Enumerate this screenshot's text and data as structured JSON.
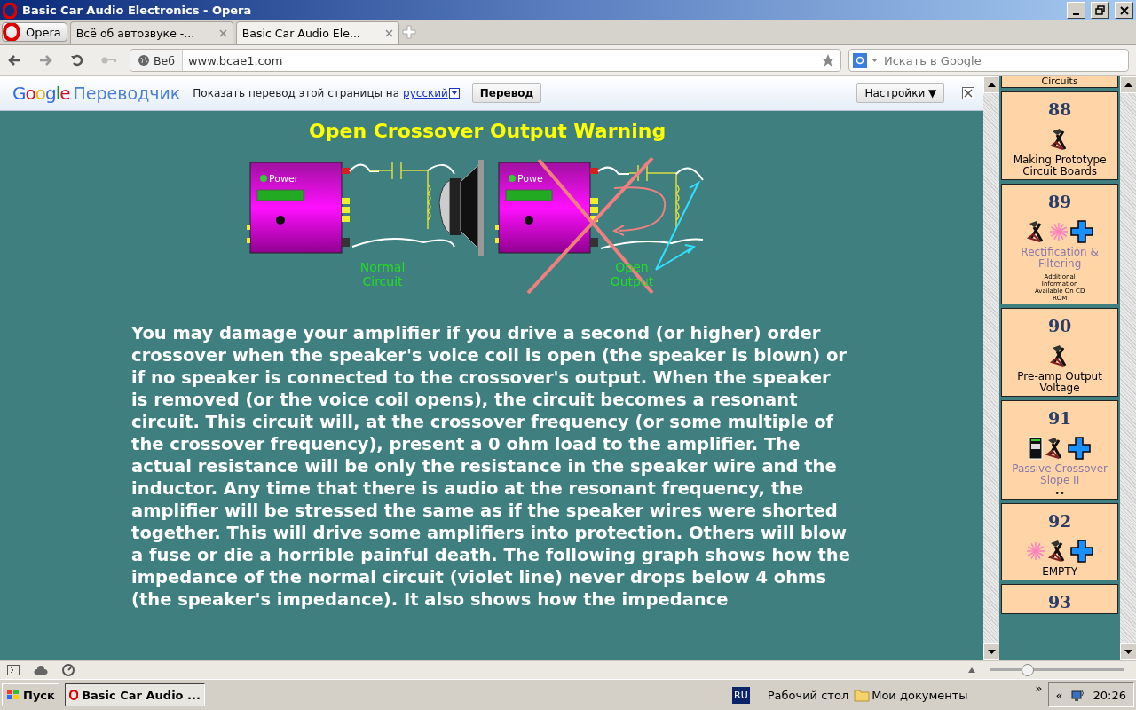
{
  "window": {
    "title": "Basic Car Audio Electronics - Opera"
  },
  "menu_button": "Opera",
  "tabs": [
    {
      "label": "Всё об автозвуке -...",
      "selected": false
    },
    {
      "label": "Basic Car Audio Ele...",
      "selected": true
    }
  ],
  "address_bar": {
    "badge": "Веб",
    "url": "www.bcae1.com"
  },
  "search": {
    "placeholder": "Искать в Google"
  },
  "translate_bar": {
    "logo_word": "Google",
    "logo_product": "Переводчик",
    "prompt": "Показать перевод этой страницы на",
    "language": "русский",
    "translate_button": "Перевод",
    "settings_button": "Настройки ▼"
  },
  "article": {
    "title": "Open Crossover Output Warning",
    "diagram": {
      "power_labels": [
        "Power",
        "Powe"
      ],
      "normal_label": "Normal Circuit",
      "open_label": "Open Output"
    },
    "paragraph": "You may damage your amplifier if you drive a second (or higher) order crossover when the speaker's voice coil is open (the speaker is blown) or if no speaker is connected to the crossover's output. When the speaker is removed (or the voice coil opens), the circuit becomes a resonant circuit. This circuit will, at the crossover frequency (or some multiple of the crossover frequency), present a 0 ohm load to the amplifier. The actual resistance will be only the resistance in the speaker wire and the inductor. Any time that there is audio at the resonant frequency, the amplifier will be stressed the same as if the speaker wires were shorted together. This will drive some amplifiers into protection. Others will blow a fuse or die a horrible painful death. The following graph shows how the impedance of the normal circuit (violet line) never drops below 4 ohms (the speaker's impedance). It also shows how the impedance"
  },
  "sidebar": {
    "partial_title": "Circuits",
    "items": [
      {
        "number": "88",
        "icons": [
          {
            "kind": "tools"
          }
        ],
        "title": "Making Prototype Circuit Boards",
        "dimmed": false
      },
      {
        "number": "89",
        "icons": [
          {
            "kind": "tools"
          },
          {
            "kind": "spark"
          },
          {
            "kind": "plus"
          }
        ],
        "title": "Rectification & Filtering",
        "dimmed": true,
        "note": "Additional Information Available On CD ROM"
      },
      {
        "number": "90",
        "icons": [
          {
            "kind": "tools"
          }
        ],
        "title": "Pre-amp Output Voltage",
        "dimmed": false
      },
      {
        "number": "91",
        "icons": [
          {
            "kind": "meter"
          },
          {
            "kind": "tools"
          },
          {
            "kind": "plus"
          }
        ],
        "title": "Passive Crossover Slope II",
        "dimmed": true,
        "dots": "••"
      },
      {
        "number": "92",
        "icons": [
          {
            "kind": "spark"
          },
          {
            "kind": "tools"
          },
          {
            "kind": "plus"
          }
        ],
        "title": "EMPTY",
        "dimmed": false
      },
      {
        "number": "93",
        "dimmed": false
      }
    ]
  },
  "status_bar": {
    "zoom": {
      "level": 0.27
    }
  },
  "taskbar": {
    "start": "Пуск",
    "window_button": "Basic Car Audio ...",
    "language": "RU",
    "toolbars": [
      "Рабочий стол",
      "Мои документы"
    ],
    "more": "»",
    "tray_toggle": "«",
    "clock": "20:26"
  }
}
